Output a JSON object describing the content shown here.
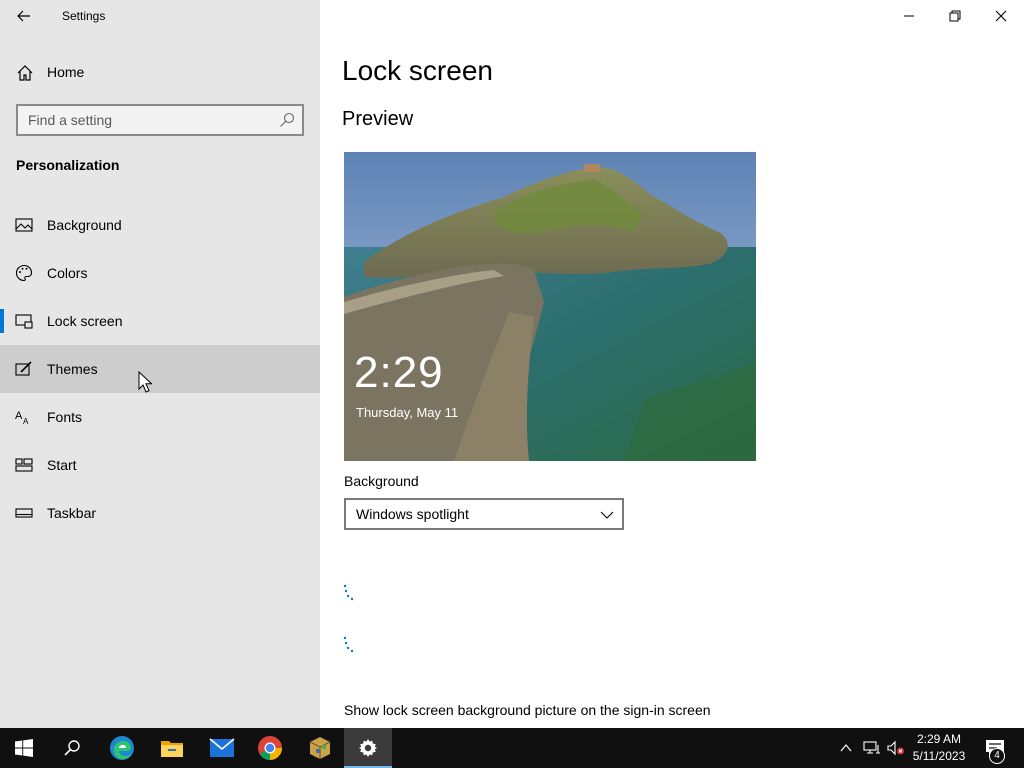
{
  "window": {
    "title": "Settings",
    "controls": {
      "minimize": "minimize",
      "restore": "restore",
      "close": "close"
    }
  },
  "sidebar": {
    "home_label": "Home",
    "search": {
      "placeholder": "Find a setting",
      "value": ""
    },
    "section_title": "Personalization",
    "items": [
      {
        "label": "Background",
        "icon": "picture-icon",
        "selected": false
      },
      {
        "label": "Colors",
        "icon": "palette-icon",
        "selected": false
      },
      {
        "label": "Lock screen",
        "icon": "lock-screen-icon",
        "selected": true
      },
      {
        "label": "Themes",
        "icon": "themes-icon",
        "selected": false
      },
      {
        "label": "Fonts",
        "icon": "fonts-icon",
        "selected": false
      },
      {
        "label": "Start",
        "icon": "start-icon",
        "selected": false
      },
      {
        "label": "Taskbar",
        "icon": "taskbar-icon",
        "selected": false
      }
    ]
  },
  "main": {
    "title": "Lock screen",
    "preview_heading": "Preview",
    "preview": {
      "time": "2:29",
      "date": "Thursday, May 11"
    },
    "background": {
      "label": "Background",
      "selected": "Windows spotlight"
    },
    "signin_option_label": "Show lock screen background picture on the sign-in screen"
  },
  "taskbar": {
    "apps": [
      "start-icon",
      "search-icon",
      "edge-icon",
      "file-explorer-icon",
      "mail-icon",
      "chrome-icon",
      "package-icon",
      "settings-icon"
    ],
    "clock_time": "2:29 AM",
    "clock_date": "5/11/2023",
    "notification_count": "4"
  },
  "colors": {
    "accent": "#0078d7",
    "sidebar_bg": "#e6e6e6",
    "hover_bg": "#cdcdcd",
    "taskbar_bg": "#101010"
  }
}
